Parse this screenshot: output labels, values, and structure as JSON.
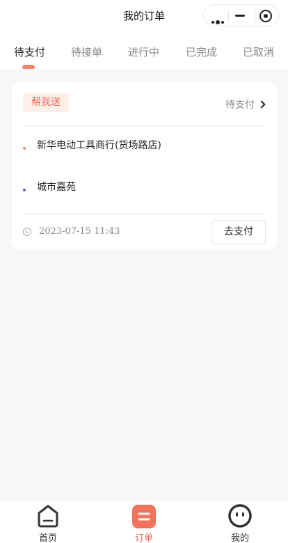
{
  "navbar": {
    "title": "我的订单",
    "capsule_icons": [
      "more-icon",
      "minimize-icon",
      "target-icon"
    ]
  },
  "tabs": [
    {
      "label": "待支付",
      "active": true
    },
    {
      "label": "待接单",
      "active": false
    },
    {
      "label": "进行中",
      "active": false
    },
    {
      "label": "已完成",
      "active": false
    },
    {
      "label": "已取消",
      "active": false
    }
  ],
  "order": {
    "type_badge": "帮我送",
    "status": "待支付",
    "pickup_address": "新华电动工具商行(货场路店)",
    "delivery_address": "城市嘉苑",
    "time": "2023-07-15 11:43",
    "pay_button": "去支付"
  },
  "bottom_tabs": [
    {
      "label": "首页",
      "icon": "home-icon",
      "active": false
    },
    {
      "label": "订单",
      "icon": "order-icon",
      "active": true
    },
    {
      "label": "我的",
      "icon": "profile-icon",
      "active": false
    }
  ],
  "colors": {
    "accent": "#f0846d",
    "badge_bg": "#fdeeea",
    "badge_text": "#e46f5b",
    "pickup_dot": "#ef8a6e",
    "delivery_dot": "#5b5fc0",
    "background": "#f7f7f7"
  }
}
